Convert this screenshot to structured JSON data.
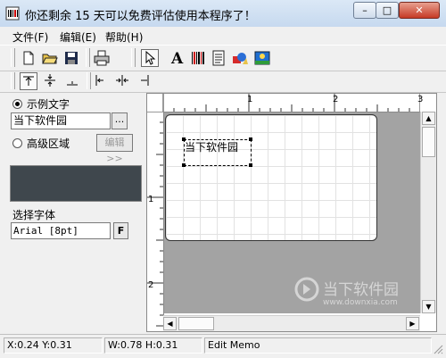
{
  "window": {
    "title": "你还剩余 15 天可以免费评估使用本程序了！",
    "minimize_glyph": "–",
    "maximize_glyph": "□",
    "close_glyph": "✕"
  },
  "menu": {
    "items": [
      {
        "label": "文件(F)"
      },
      {
        "label": "编辑(E)"
      },
      {
        "label": "帮助(H)"
      }
    ]
  },
  "toolbar": {
    "tools": [
      "new-file-icon",
      "open-folder-icon",
      "save-icon",
      "print-icon",
      "select-pointer-icon",
      "text-tool-icon",
      "barcode-tool-icon",
      "memo-tool-icon",
      "shape-tool-icon",
      "image-tool-icon"
    ],
    "align_tools": [
      "align-top-icon",
      "align-vcenter-icon",
      "align-bottom-icon",
      "align-left-icon",
      "align-hcenter-icon",
      "align-right-icon"
    ]
  },
  "left_panel": {
    "sample_text_label": "示例文字",
    "sample_text_value": "当下软件园",
    "browse_label": "...",
    "advanced_label": "高级区域",
    "edit_button_label": "编辑>>",
    "font_label": "选择字体",
    "font_value": "Arial [8pt]",
    "font_button_label": "F",
    "preview_color": "#3f474d"
  },
  "canvas": {
    "ruler_h_labels": [
      "1",
      "2",
      "3"
    ],
    "ruler_v_labels": [
      "1",
      "2"
    ],
    "selected_text": "当下软件园"
  },
  "status": {
    "position": "X:0.24  Y:0.31",
    "size": "W:0.78  H:0.31",
    "mode": "Edit Memo"
  },
  "watermark": {
    "brand": "当下软件园",
    "url": "www.downxia.com"
  }
}
